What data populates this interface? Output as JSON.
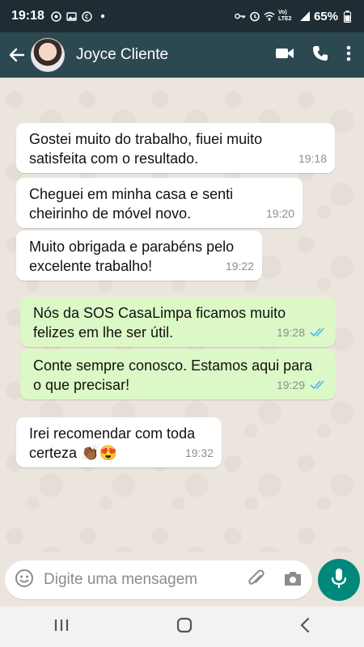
{
  "status_bar": {
    "time": "19:18",
    "battery": "65%",
    "network": "Vo) LTE2"
  },
  "header": {
    "contact_name": "Joyce Cliente"
  },
  "messages": [
    {
      "text": "Gostei muito do trabalho, fiuei muito satisfeita com o resultado.",
      "time": "19:18",
      "direction": "in"
    },
    {
      "text": "Cheguei em minha casa e senti cheirinho de móvel novo.",
      "time": "19:20",
      "direction": "in"
    },
    {
      "text": "Muito obrigada e parabéns pelo excelente trabalho!",
      "time": "19:22",
      "direction": "in"
    },
    {
      "text": "Nós da SOS CasaLimpa ficamos muito felizes em lhe ser útil.",
      "time": "19:28",
      "direction": "out",
      "status": "read"
    },
    {
      "text": "Conte sempre conosco. Estamos aqui para o que precisar!",
      "time": "19:29",
      "direction": "out",
      "status": "read"
    },
    {
      "text": "Irei recomendar com toda certeza 👏🏾😍",
      "time": "19:32",
      "direction": "in"
    }
  ],
  "input": {
    "placeholder": "Digite uma mensagem"
  },
  "icons": {
    "back": "back-arrow-icon",
    "video": "video-call-icon",
    "call": "phone-icon",
    "menu": "more-vert-icon",
    "emoji": "emoji-icon",
    "attach": "paperclip-icon",
    "camera": "camera-icon",
    "mic": "mic-icon"
  },
  "colors": {
    "header": "#2c4952",
    "status_bar": "#1f2c34",
    "incoming_bubble": "#ffffff",
    "outgoing_bubble": "#dcf8c6",
    "read_ticks": "#4fb6ec",
    "mic_button": "#00897b"
  }
}
